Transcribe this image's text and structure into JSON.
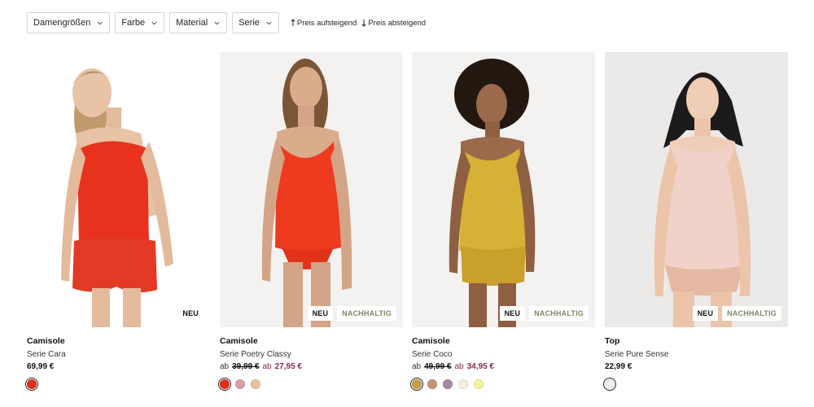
{
  "filters": [
    {
      "label": "Damengrößen"
    },
    {
      "label": "Farbe"
    },
    {
      "label": "Material"
    },
    {
      "label": "Serie"
    }
  ],
  "sort": {
    "asc_label": "Preis aufsteigend",
    "desc_label": "Preis absteigend"
  },
  "products": [
    {
      "title": "Camisole",
      "series": "Serie Cara",
      "price": "69,99 €",
      "badges": [
        "NEU"
      ],
      "garment_color": "#e8321e",
      "skin": "#e8c3a6",
      "hair": "#b99566",
      "swatches": [
        "#e0301c"
      ]
    },
    {
      "title": "Camisole",
      "series": "Serie Poetry Classy",
      "price_prefix": "ab",
      "price_old": "39,99 €",
      "price_sale_prefix": "ab",
      "price_sale": "27,95 €",
      "badges": [
        "NEU",
        "NACHHALTIG"
      ],
      "garment_color": "#ee3a1e",
      "skin": "#d9ac8c",
      "hair": "#7a5536",
      "swatches": [
        "#e0301c",
        "#d6a0ad",
        "#e3c29c"
      ]
    },
    {
      "title": "Camisole",
      "series": "Serie Coco",
      "price_prefix": "ab",
      "price_old": "49,99 €",
      "price_sale_prefix": "ab",
      "price_sale": "34,95 €",
      "badges": [
        "NEU",
        "NACHHALTIG"
      ],
      "garment_color": "#d6b136",
      "skin": "#9b6a4b",
      "hair": "#231810",
      "swatches": [
        "#c3a049",
        "#c39475",
        "#a58ba0",
        "#f5f0de",
        "#f7f09a"
      ]
    },
    {
      "title": "Top",
      "series": "Serie Pure Sense",
      "price": "22,99 €",
      "badges": [
        "NEU",
        "NACHHALTIG"
      ],
      "garment_color": "#f0d2c8",
      "skin": "#f0cdb6",
      "hair": "#1c1a1a",
      "swatches": [
        "#efefef"
      ]
    }
  ]
}
